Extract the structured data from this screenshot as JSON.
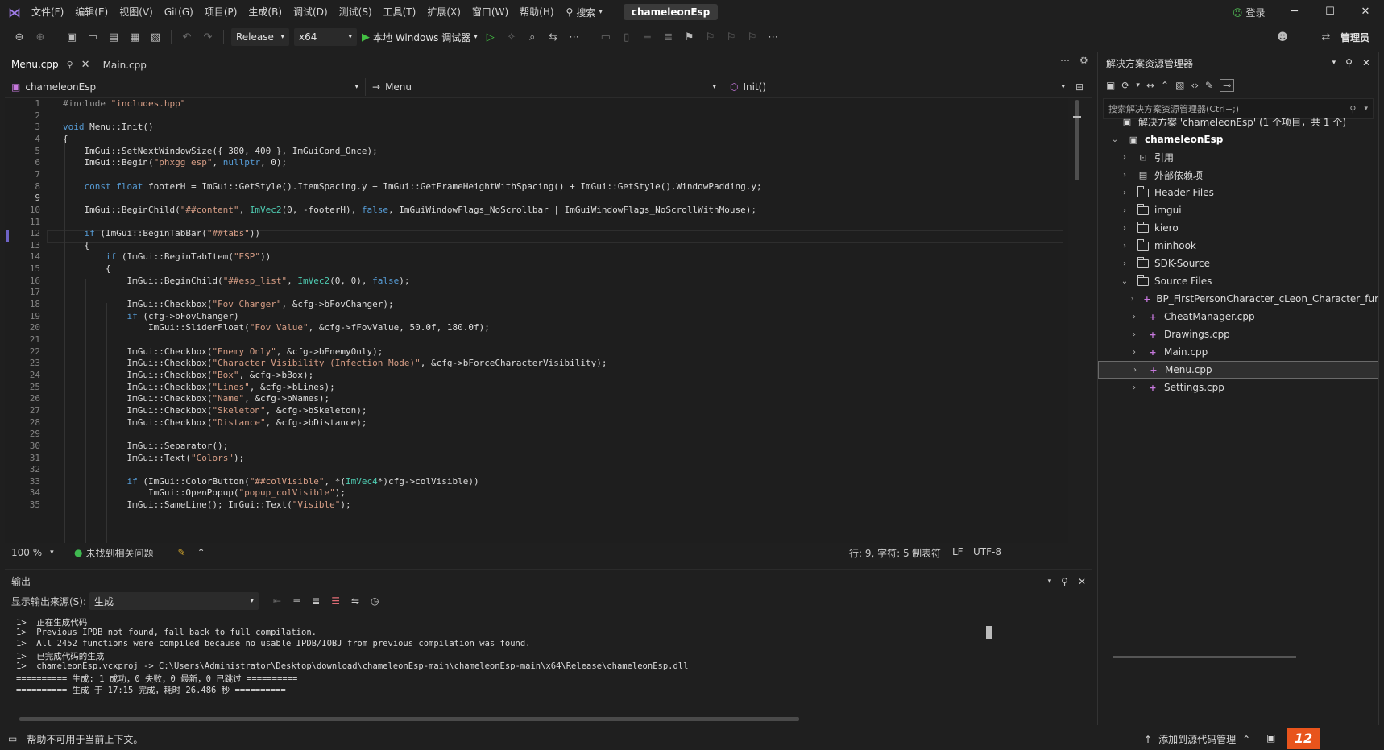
{
  "titlebar": {
    "menus": [
      "文件(F)",
      "编辑(E)",
      "视图(V)",
      "Git(G)",
      "项目(P)",
      "生成(B)",
      "调试(D)",
      "测试(S)",
      "工具(T)",
      "扩展(X)",
      "窗口(W)",
      "帮助(H)"
    ],
    "search_label": "搜索",
    "solution_name": "chameleonEsp",
    "login_label": "登录",
    "admin_label": "管理员"
  },
  "toolbar": {
    "config": "Release",
    "platform": "x64",
    "run_label": "本地 Windows 调试器"
  },
  "tabs": [
    {
      "label": "Menu.cpp"
    },
    {
      "label": "Main.cpp"
    }
  ],
  "navbar": {
    "project": "chameleonEsp",
    "scope": "Menu",
    "member": "Init()"
  },
  "code_lines": [
    "#include \"includes.hpp\"",
    "",
    "void Menu::Init()",
    "{",
    "    ImGui::SetNextWindowSize({ 300, 400 }, ImGuiCond_Once);",
    "    ImGui::Begin(\"phxgg esp\", nullptr, 0);",
    "",
    "    const float footerH = ImGui::GetStyle().ItemSpacing.y + ImGui::GetFrameHeightWithSpacing() + ImGui::GetStyle().WindowPadding.y;",
    "",
    "    ImGui::BeginChild(\"##content\", ImVec2(0, -footerH), false, ImGuiWindowFlags_NoScrollbar | ImGuiWindowFlags_NoScrollWithMouse);",
    "",
    "    if (ImGui::BeginTabBar(\"##tabs\"))",
    "    {",
    "        if (ImGui::BeginTabItem(\"ESP\"))",
    "        {",
    "            ImGui::BeginChild(\"##esp_list\", ImVec2(0, 0), false);",
    "",
    "            ImGui::Checkbox(\"Fov Changer\", &cfg->bFovChanger);",
    "            if (cfg->bFovChanger)",
    "                ImGui::SliderFloat(\"Fov Value\", &cfg->fFovValue, 50.0f, 180.0f);",
    "",
    "            ImGui::Checkbox(\"Enemy Only\", &cfg->bEnemyOnly);",
    "            ImGui::Checkbox(\"Character Visibility (Infection Mode)\", &cfg->bForceCharacterVisibility);",
    "            ImGui::Checkbox(\"Box\", &cfg->bBox);",
    "            ImGui::Checkbox(\"Lines\", &cfg->bLines);",
    "            ImGui::Checkbox(\"Name\", &cfg->bNames);",
    "            ImGui::Checkbox(\"Skeleton\", &cfg->bSkeleton);",
    "            ImGui::Checkbox(\"Distance\", &cfg->bDistance);",
    "",
    "            ImGui::Separator();",
    "            ImGui::Text(\"Colors\");",
    "",
    "            if (ImGui::ColorButton(\"##colVisible\", *(ImVec4*)cfg->colVisible))",
    "                ImGui::OpenPopup(\"popup_colVisible\");",
    "            ImGui::SameLine(); ImGui::Text(\"Visible\");"
  ],
  "current_line": 9,
  "editor_status": {
    "zoom": "100 %",
    "issues": "未找到相关问题",
    "position": "行: 9, 字符: 5",
    "indent": "制表符",
    "eol": "LF",
    "encoding": "UTF-8"
  },
  "solution_explorer": {
    "title": "解决方案资源管理器",
    "search_placeholder": "搜索解决方案资源管理器(Ctrl+;)",
    "solution_label": "解决方案 'chameleonEsp' (1 个项目，共 1 个)",
    "project": "chameleonEsp",
    "nodes": [
      {
        "label": "引用",
        "kind": "ref"
      },
      {
        "label": "外部依赖项",
        "kind": "ext"
      },
      {
        "label": "Header Files",
        "kind": "folder"
      },
      {
        "label": "imgui",
        "kind": "folder"
      },
      {
        "label": "kiero",
        "kind": "folder"
      },
      {
        "label": "minhook",
        "kind": "folder"
      },
      {
        "label": "SDK-Source",
        "kind": "folder"
      },
      {
        "label": "Source Files",
        "kind": "folder-open"
      }
    ],
    "source_files": [
      "BP_FirstPersonCharacter_cLeon_Character_fur",
      "CheatManager.cpp",
      "Drawings.cpp",
      "Main.cpp",
      "Menu.cpp",
      "Settings.cpp"
    ]
  },
  "output": {
    "title": "输出",
    "source_label": "显示输出来源(S):",
    "source_value": "生成",
    "lines": [
      "1>  正在生成代码",
      "1>  Previous IPDB not found, fall back to full compilation.",
      "1>  All 2452 functions were compiled because no usable IPDB/IOBJ from previous compilation was found.",
      "1>  已完成代码的生成",
      "1>  chameleonEsp.vcxproj -> C:\\Users\\Administrator\\Desktop\\download\\chameleonEsp-main\\chameleonEsp-main\\x64\\Release\\chameleonEsp.dll",
      "========== 生成: 1 成功，0 失败，0 最新，0 已跳过 ==========",
      "========== 生成 于 17:15 完成，耗时 26.486 秒 =========="
    ]
  },
  "statusbar": {
    "help_text": "帮助不可用于当前上下文。",
    "source_control": "添加到源代码管理"
  }
}
